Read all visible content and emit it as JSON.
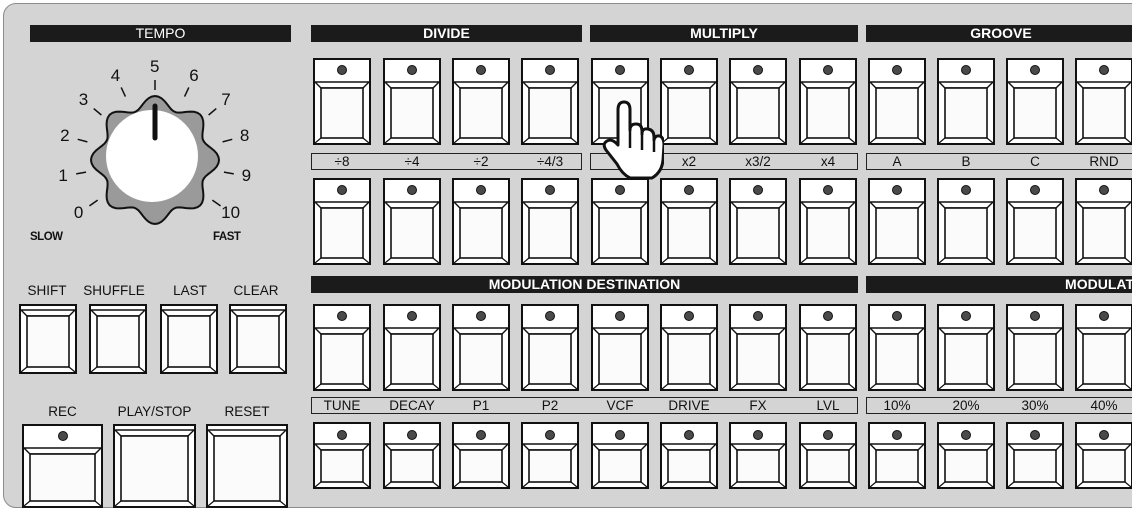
{
  "tempo": {
    "header": "TEMPO",
    "dial_numbers": [
      "0",
      "1",
      "2",
      "3",
      "4",
      "5",
      "6",
      "7",
      "8",
      "9",
      "10"
    ],
    "slow_label": "SLOW",
    "fast_label": "FAST"
  },
  "sections": {
    "divide": "DIVIDE",
    "multiply": "MULTIPLY",
    "groove": "GROOVE",
    "mod_destination": "MODULATION DESTINATION",
    "modulation": "MODULAT"
  },
  "rate_labels": [
    "÷8",
    "÷4",
    "÷2",
    "÷4/3",
    "",
    "x2",
    "x3/2",
    "x4",
    "A",
    "B",
    "C",
    "RND"
  ],
  "mod_labels": [
    "TUNE",
    "DECAY",
    "P1",
    "P2",
    "VCF",
    "DRIVE",
    "FX",
    "LVL",
    "10%",
    "20%",
    "30%",
    "40%"
  ],
  "transport": {
    "row1": [
      "SHIFT",
      "SHUFFLE",
      "LAST",
      "CLEAR"
    ],
    "row2": [
      "REC",
      "PLAY/STOP",
      "RESET"
    ]
  },
  "icons": {
    "cursor": "pointing-hand-icon",
    "led": "led-indicator-icon"
  },
  "colors": {
    "panel": "#d4d4d4",
    "header": "#1b1b1b",
    "led": "#4a4a4a"
  }
}
